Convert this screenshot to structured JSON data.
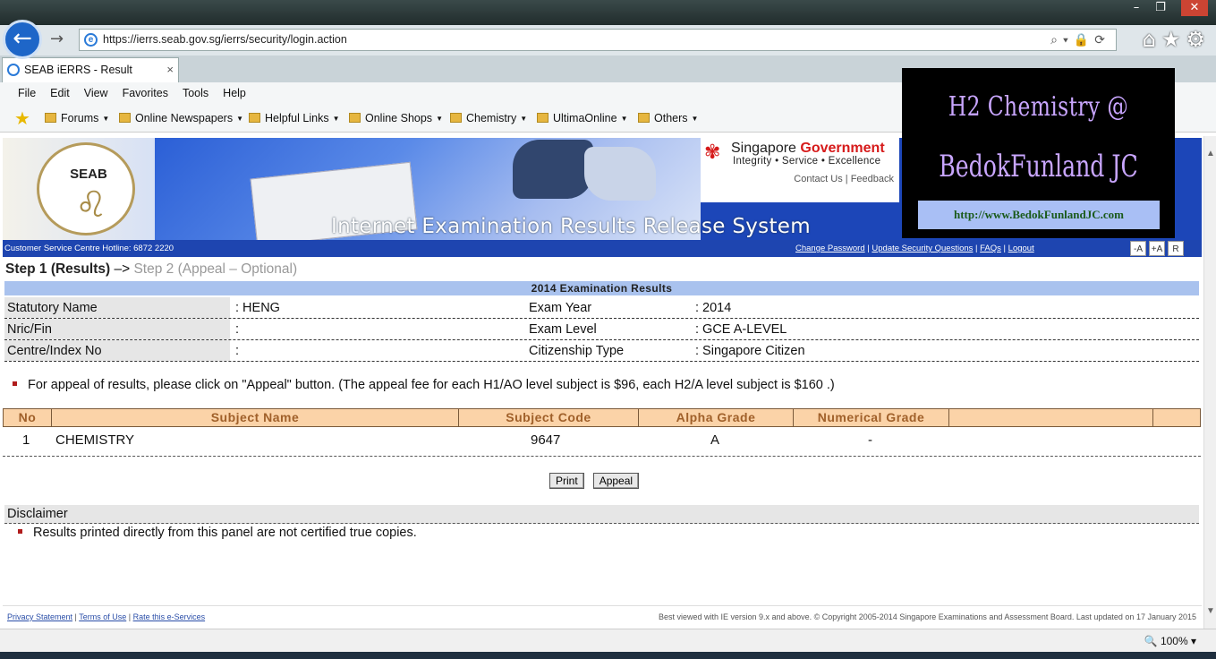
{
  "browser": {
    "url": "https://ierrs.seab.gov.sg/ierrs/security/login.action",
    "tab_title": "SEAB iERRS - Result",
    "tab_close": "×",
    "menu": [
      "File",
      "Edit",
      "View",
      "Favorites",
      "Tools",
      "Help"
    ],
    "favorites": [
      "Forums",
      "Online Newspapers",
      "Helpful Links",
      "Online Shops",
      "Chemistry",
      "UltimaOnline",
      "Others"
    ],
    "zoom": "100%"
  },
  "banner": {
    "seal_text": "SEAB",
    "title": "Internet Examination Results Release System",
    "gov_name_1": "Singapore",
    "gov_name_2": "Government",
    "gov_motto": "Integrity • Service • Excellence",
    "contact": "Contact Us",
    "feedback": "Feedback",
    "hotline": "Customer Service Centre Hotline: 6872 2220",
    "links": [
      "Change Password",
      "Update Security Questions",
      "FAQs",
      "Logout"
    ],
    "font_buttons": [
      "-A",
      "+A",
      "R"
    ]
  },
  "steps": {
    "step1": "Step 1 (Results)",
    "arrow": "–>",
    "step2": "Step 2 (Appeal – Optional)"
  },
  "results": {
    "heading": "2014 Examination Results",
    "statutory_name_label": "Statutory Name",
    "statutory_name": ": HENG",
    "nric_label": "Nric/Fin",
    "nric": ":",
    "centre_label": "Centre/Index No",
    "centre": ":",
    "exam_year_label": "Exam Year",
    "exam_year": ": 2014",
    "exam_level_label": "Exam Level",
    "exam_level": ": GCE A-LEVEL",
    "citizenship_label": "Citizenship Type",
    "citizenship": ": Singapore Citizen"
  },
  "appeal_note": "For appeal of results, please click on \"Appeal\" button. (The appeal fee for each H1/AO level subject is $96, each H2/A level subject is $160 .)",
  "table": {
    "headers": [
      "No",
      "Subject Name",
      "Subject Code",
      "Alpha Grade",
      "Numerical Grade",
      "",
      ""
    ],
    "rows": [
      {
        "no": "1",
        "subject": "CHEMISTRY",
        "code": "9647",
        "alpha": "A",
        "numerical": "-"
      }
    ]
  },
  "buttons": {
    "print": "Print",
    "appeal": "Appeal"
  },
  "disclaimer": {
    "heading": "Disclaimer",
    "text": "Results printed directly from this panel are not certified true copies."
  },
  "footer": {
    "links": [
      "Privacy Statement",
      "Terms of Use",
      "Rate this e-Services"
    ],
    "right": "Best viewed with IE version 9.x and above. © Copyright 2005-2014 Singapore Examinations and Assessment Board. Last updated on 17 January 2015"
  },
  "overlay": {
    "line1": "H2 Chemistry @",
    "line2": "BedokFunland JC",
    "url": "http://www.BedokFunlandJC.com"
  },
  "colors": {
    "banner_blue": "#1e45b0",
    "table_header": "#fbd3a8",
    "results_header": "#a9c2ee",
    "overlay_text": "#c9a6ff"
  }
}
